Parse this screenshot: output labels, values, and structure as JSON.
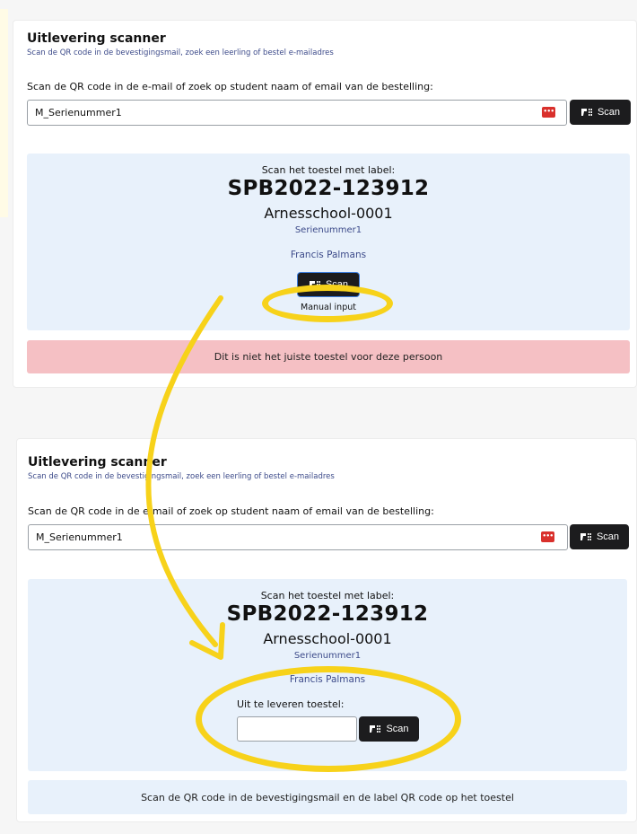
{
  "top": {
    "title": "Uitlevering scanner",
    "subtitle": "Scan de QR code in de bevestigingsmail, zoek een leerling of bestel e-mailadres",
    "prompt": "Scan de QR code in de e-mail of zoek op student naam of email van de bestelling:",
    "search_value": "M_Serienummer1",
    "scan_label": "Scan",
    "panel": {
      "heading": "Scan het toestel met label:",
      "label": "SPB2022-123912",
      "school": "Arnesschool-0001",
      "serial": "Serienummer1",
      "person": "Francis Palmans",
      "scan_label": "Scan",
      "manual": "Manual input"
    },
    "alert": "Dit is niet het juiste toestel voor deze persoon"
  },
  "bottom": {
    "title": "Uitlevering scanner",
    "subtitle": "Scan de QR code in de bevestigingsmail, zoek een leerling of bestel e-mailadres",
    "prompt": "Scan de QR code in de e-mail of zoek op student naam of email van de bestelling:",
    "search_value": "M_Serienummer1",
    "scan_label": "Scan",
    "panel": {
      "heading": "Scan het toestel met label:",
      "label": "SPB2022-123912",
      "school": "Arnesschool-0001",
      "serial": "Serienummer1",
      "person": "Francis Palmans",
      "input_label": "Uit te leveren toestel:",
      "input_value": "",
      "scan_label": "Scan"
    },
    "info": "Scan de QR code in de bevestigingsmail en de label QR code op het toestel"
  },
  "colors": {
    "highlight": "#f7d21a",
    "panel_bg": "#e8f1fb",
    "danger_bg": "#f5c0c4",
    "button_dark": "#1c1c1e",
    "password_icon": "#d9302c"
  },
  "icons": {
    "scan": "barcode-scanner-icon",
    "password_manager": "password-manager-icon"
  }
}
